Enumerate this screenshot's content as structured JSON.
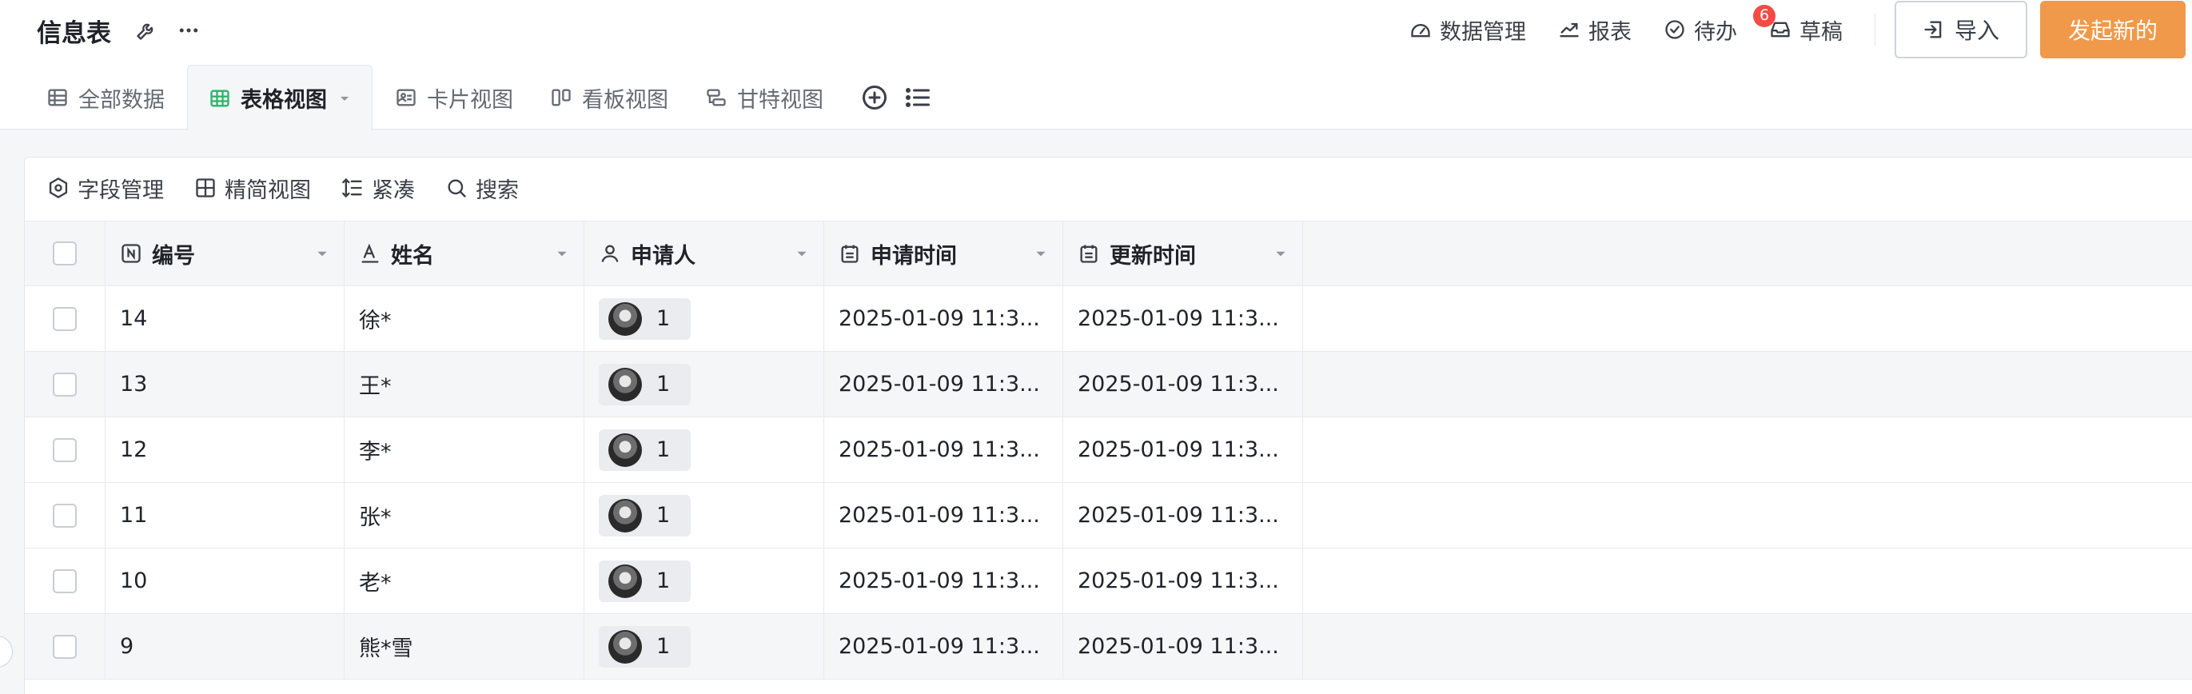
{
  "app": {
    "title": "信息表"
  },
  "header_icons": [
    "wrench-icon",
    "more-icon"
  ],
  "actions": {
    "data_manage": "数据管理",
    "report": "报表",
    "todo": "待办",
    "todo_badge": "6",
    "draft": "草稿",
    "import": "导入",
    "primary": "发起新的"
  },
  "tabs": [
    {
      "label": "全部数据",
      "icon": "table-icon",
      "active": false
    },
    {
      "label": "表格视图",
      "icon": "grid-view-icon",
      "active": true
    },
    {
      "label": "卡片视图",
      "icon": "card-view-icon",
      "active": false
    },
    {
      "label": "看板视图",
      "icon": "kanban-view-icon",
      "active": false
    },
    {
      "label": "甘特视图",
      "icon": "gantt-view-icon",
      "active": false
    }
  ],
  "toolbar": {
    "fields": "字段管理",
    "compact_view": "精简视图",
    "density": "紧凑",
    "search": "搜索"
  },
  "table": {
    "columns": [
      {
        "label": "编号",
        "icon": "number-field-icon"
      },
      {
        "label": "姓名",
        "icon": "text-field-icon"
      },
      {
        "label": "申请人",
        "icon": "person-field-icon"
      },
      {
        "label": "申请时间",
        "icon": "date-field-icon"
      },
      {
        "label": "更新时间",
        "icon": "date-field-icon"
      }
    ],
    "rows": [
      {
        "id": "14",
        "name": "徐*",
        "applicant": "1",
        "applied": "2025-01-09 11:3...",
        "updated": "2025-01-09 11:3..."
      },
      {
        "id": "13",
        "name": "王*",
        "applicant": "1",
        "applied": "2025-01-09 11:3...",
        "updated": "2025-01-09 11:3..."
      },
      {
        "id": "12",
        "name": "李*",
        "applicant": "1",
        "applied": "2025-01-09 11:3...",
        "updated": "2025-01-09 11:3..."
      },
      {
        "id": "11",
        "name": "张*",
        "applicant": "1",
        "applied": "2025-01-09 11:3...",
        "updated": "2025-01-09 11:3..."
      },
      {
        "id": "10",
        "name": "老*",
        "applicant": "1",
        "applied": "2025-01-09 11:3...",
        "updated": "2025-01-09 11:3..."
      },
      {
        "id": "9",
        "name": "熊*雪",
        "applicant": "1",
        "applied": "2025-01-09 11:3...",
        "updated": "2025-01-09 11:3..."
      }
    ]
  },
  "colors": {
    "primary": "#f0994a",
    "badge": "#f54a45",
    "active_tab_icon": "#2fb36b"
  }
}
